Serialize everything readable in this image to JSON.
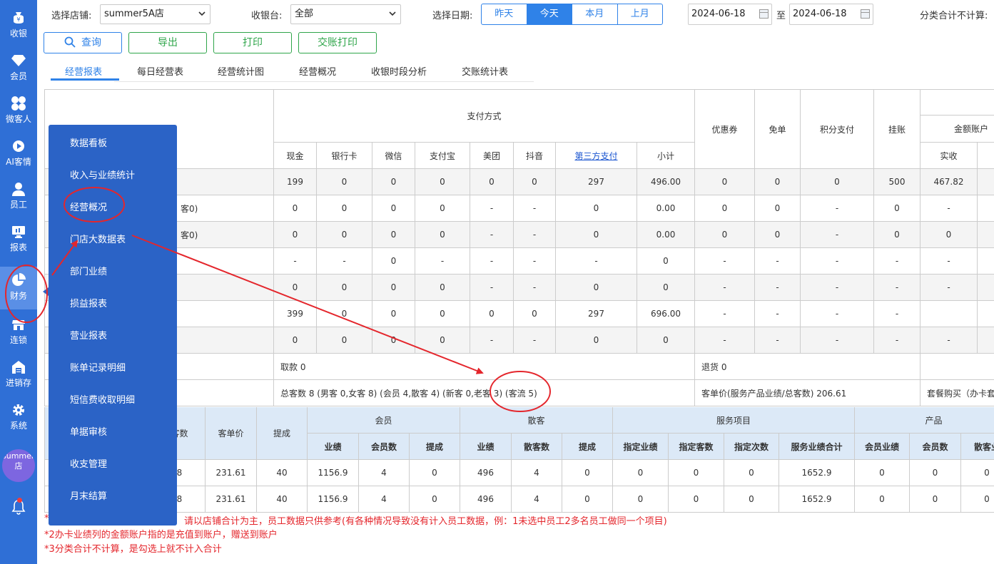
{
  "sidebar": {
    "items": [
      {
        "label": "收银",
        "icon": "cashier-icon"
      },
      {
        "label": "会员",
        "icon": "diamond-icon"
      },
      {
        "label": "微客人",
        "icon": "clover-icon"
      },
      {
        "label": "AI客情",
        "icon": "play-circle-icon"
      },
      {
        "label": "员工",
        "icon": "person-icon"
      },
      {
        "label": "报表",
        "icon": "monitor-icon"
      },
      {
        "label": "财务",
        "icon": "pie-chart-icon"
      },
      {
        "label": "连锁",
        "icon": "store-icon"
      },
      {
        "label": "进销存",
        "icon": "warehouse-icon"
      },
      {
        "label": "系统",
        "icon": "gear-icon"
      }
    ],
    "store_avatar": "summer5A店",
    "bell_icon": "bell-icon"
  },
  "filters": {
    "store_label": "选择店铺:",
    "store_value": "summer5A店",
    "register_label": "收银台:",
    "register_value": "全部",
    "date_label": "选择日期:",
    "date_options": [
      "昨天",
      "今天",
      "本月",
      "上月"
    ],
    "date_selected": "今天",
    "start_date": "2024-06-18",
    "to_label": "至",
    "end_date": "2024-06-18",
    "category_note": "分类合计不计算:"
  },
  "actions": {
    "query": "查询",
    "export": "导出",
    "print": "打印",
    "handover_print": "交账打印"
  },
  "tabs": [
    "经营报表",
    "每日经营表",
    "经营统计图",
    "经营概况",
    "收银时段分析",
    "交账统计表"
  ],
  "table1": {
    "group_pay": "支付方式",
    "pay_cols": [
      "现金",
      "银行卡",
      "微信",
      "支付宝",
      "美团",
      "抖音",
      "第三方支付",
      "小计"
    ],
    "other_cols": [
      "优惠券",
      "免单",
      "积分支付",
      "挂账"
    ],
    "balance_group": "金额账户",
    "balance_sub": "实收",
    "rows": [
      {
        "label": "",
        "cells": [
          "199",
          "0",
          "0",
          "0",
          "0",
          "0",
          "297",
          "496.00",
          "0",
          "0",
          "0",
          "500",
          "467.82"
        ]
      },
      {
        "label": "客0)",
        "cells": [
          "0",
          "0",
          "0",
          "0",
          "-",
          "-",
          "0",
          "0.00",
          "0",
          "0",
          "-",
          "0",
          "-"
        ]
      },
      {
        "label": "客0)",
        "cells": [
          "0",
          "0",
          "0",
          "0",
          "-",
          "-",
          "0",
          "0.00",
          "0",
          "0",
          "-",
          "0",
          "0"
        ]
      },
      {
        "label": "",
        "cells": [
          "-",
          "-",
          "0",
          "-",
          "-",
          "-",
          "-",
          "0",
          "-",
          "-",
          "-",
          "-",
          "-"
        ]
      },
      {
        "label": "",
        "cells": [
          "0",
          "0",
          "0",
          "0",
          "-",
          "-",
          "0",
          "0",
          "-",
          "-",
          "-",
          "-",
          "-"
        ]
      },
      {
        "label": "",
        "cells": [
          "399",
          "0",
          "0",
          "0",
          "0",
          "0",
          "297",
          "696.00",
          "-",
          "-",
          "-",
          "-",
          ""
        ]
      },
      {
        "label": "",
        "cells": [
          "0",
          "0",
          "0",
          "0",
          "-",
          "-",
          "0",
          "0",
          "-",
          "-",
          "-",
          "-",
          "-"
        ]
      }
    ],
    "withdraw": "取款 0",
    "refund": "退货 0",
    "customer_summary": "总客数 8 (男客 0,女客 8) (会员 4,散客 4) (新客 0,老客 3) (客流 5)",
    "avg_ticket": "客单价(服务产品业绩/总客数) 206.61",
    "package_buy": "套餐购买（办卡套"
  },
  "table2": {
    "headers": {
      "customers": "客数",
      "avg_price": "客单价",
      "commission": "提成",
      "member_group": "会员",
      "walkin_group": "散客",
      "service_group": "服务项目",
      "product_group": "产品",
      "member_sub": [
        "业绩",
        "会员数",
        "提成"
      ],
      "walkin_sub": [
        "业绩",
        "散客数",
        "提成"
      ],
      "service_sub": [
        "指定业绩",
        "指定客数",
        "指定次数",
        "服务业绩合计"
      ],
      "product_sub": [
        "会员业绩",
        "会员数",
        "散客业"
      ]
    },
    "rows": [
      [
        "8",
        "231.61",
        "40",
        "1156.9",
        "4",
        "0",
        "496",
        "4",
        "0",
        "0",
        "0",
        "0",
        "1652.9",
        "0",
        "0",
        "0"
      ],
      [
        "8",
        "231.61",
        "40",
        "1156.9",
        "4",
        "0",
        "496",
        "4",
        "0",
        "0",
        "0",
        "0",
        "1652.9",
        "0",
        "0",
        "0"
      ]
    ]
  },
  "notes": [
    "请以店铺合计为主，员工数据只供参考(有各种情况导致没有计入员工数据，例：1未选中员工2多名员工做同一个项目)",
    "*2办卡业绩列的金额账户指的是充值到账户，赠送到账户",
    "*3分类合计不计算，是勾选上就不计入合计"
  ],
  "finance_menu": [
    "数据看板",
    "收入与业绩统计",
    "经营概况",
    "门店大数据表",
    "部门业绩",
    "损益报表",
    "营业报表",
    "账单记录明细",
    "短信费收取明细",
    "单据审核",
    "收支管理",
    "月末结算"
  ],
  "colors": {
    "rail": "#2f6fd6",
    "menu": "#2b63c6",
    "accent": "#2f82e8",
    "annotation": "#e4262c"
  }
}
